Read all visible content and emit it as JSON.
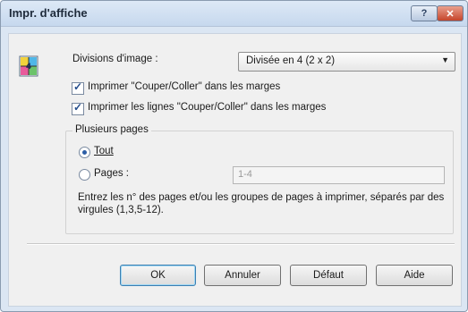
{
  "window": {
    "title": "Impr. d'affiche",
    "help_button": "?",
    "close_button": "✕"
  },
  "image_divisions": {
    "label": "Divisions d'image :",
    "selected": "Divisée en 4 (2 x 2)"
  },
  "options": [
    {
      "label": "Imprimer \"Couper/Coller\" dans les marges",
      "checked": true
    },
    {
      "label": "Imprimer les lignes \"Couper/Coller\" dans les marges",
      "checked": true
    }
  ],
  "multiple_pages": {
    "title": "Plusieurs pages",
    "all_label": "Tout",
    "pages_label": "Pages :",
    "pages_value": "1-4",
    "selected": "all",
    "description": "Entrez les n° des pages et/ou les groupes de pages à imprimer, séparés par des virgules (1,3,5-12)."
  },
  "buttons": {
    "ok": "OK",
    "cancel": "Annuler",
    "default": "Défaut",
    "help": "Aide"
  }
}
